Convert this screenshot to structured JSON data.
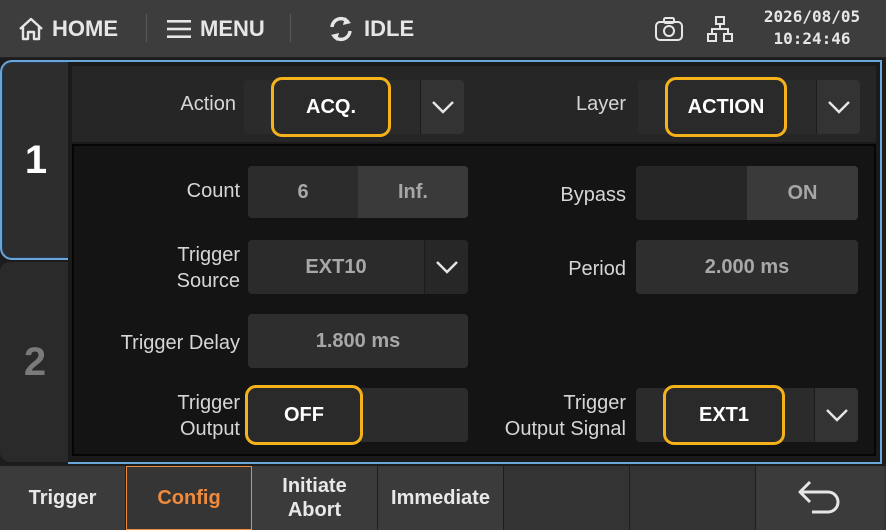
{
  "topbar": {
    "home_label": "HOME",
    "menu_label": "MENU",
    "state_label": "IDLE",
    "date": "2026/08/05",
    "time": "10:24:46",
    "icons": [
      "home-icon",
      "menu-icon",
      "refresh-icon",
      "camera-icon",
      "network-icon"
    ]
  },
  "channels": {
    "tab1": "1",
    "tab2": "2"
  },
  "header": {
    "action_label": "Action",
    "action_value": "ACQ.",
    "layer_label": "Layer",
    "layer_value": "ACTION"
  },
  "config": {
    "count_label": "Count",
    "count_value": "6",
    "count_inf": "Inf.",
    "bypass_label": "Bypass",
    "bypass_off": "",
    "bypass_on": "ON",
    "trigger_source_label": "Trigger\nSource",
    "trigger_source_value": "EXT10",
    "period_label": "Period",
    "period_value": "2.000 ms",
    "trigger_delay_label": "Trigger Delay",
    "trigger_delay_value": "1.800 ms",
    "trigger_output_label": "Trigger\nOutput",
    "trigger_output_off": "OFF",
    "trigger_output_on": "",
    "trigger_output_signal_label": "Trigger\nOutput Signal",
    "trigger_output_signal_value": "EXT1"
  },
  "softkeys": {
    "trigger": "Trigger",
    "config": "Config",
    "initiate_abort": "Initiate\nAbort",
    "immediate": "Immediate"
  },
  "colors": {
    "accent_border": "#6aa6d8",
    "highlight": "#f5b21b",
    "active_softkey": "#f08a3c"
  }
}
